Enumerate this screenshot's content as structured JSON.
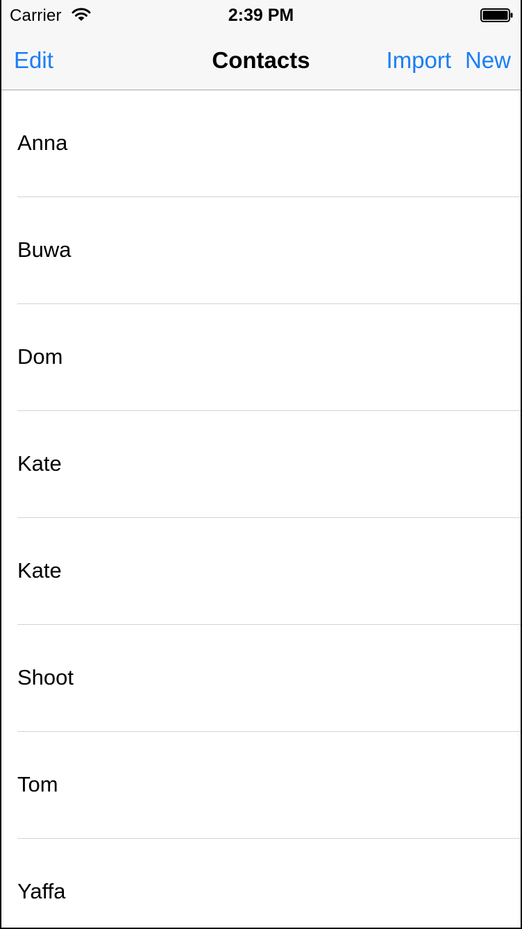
{
  "status_bar": {
    "carrier": "Carrier",
    "time": "2:39 PM",
    "wifi_icon": "wifi-icon",
    "battery_icon": "battery-icon"
  },
  "nav_bar": {
    "title": "Contacts",
    "left_button": "Edit",
    "right_buttons": [
      "Import",
      "New"
    ],
    "tint_color": "#1a7ef5"
  },
  "contacts": [
    {
      "name": "Anna"
    },
    {
      "name": "Buwa"
    },
    {
      "name": "Dom"
    },
    {
      "name": "Kate"
    },
    {
      "name": "Kate"
    },
    {
      "name": "Shoot"
    },
    {
      "name": "Tom"
    },
    {
      "name": "Yaffa"
    }
  ]
}
